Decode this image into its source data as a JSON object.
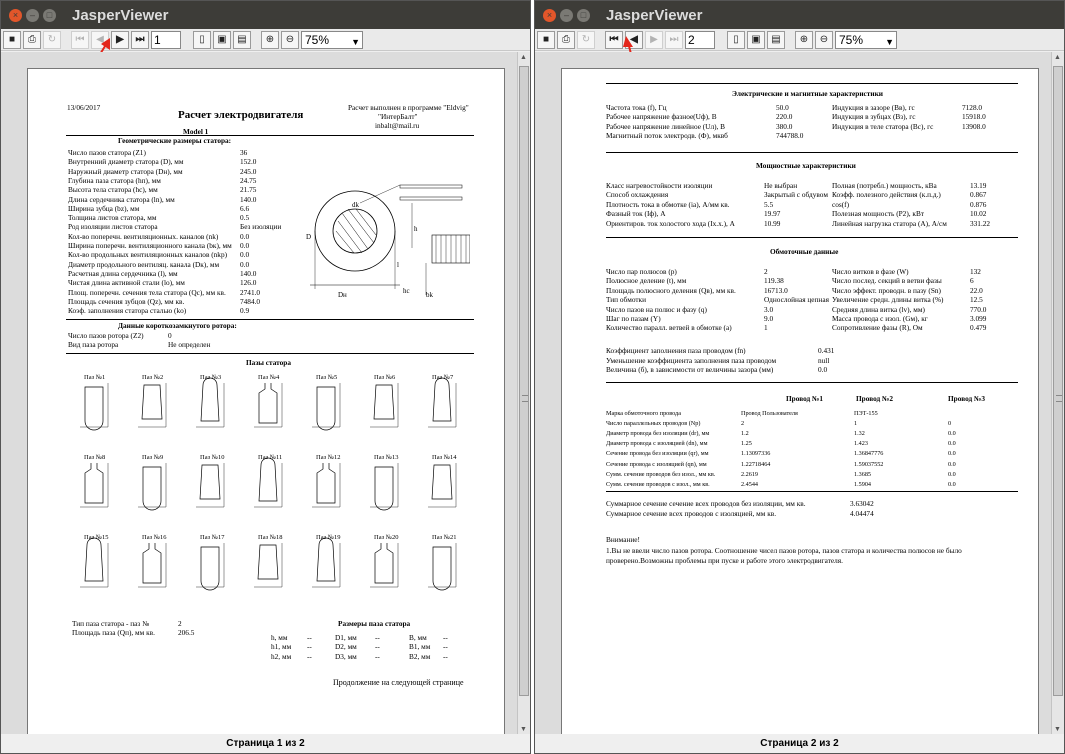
{
  "windows": [
    {
      "title": "JasperViewer",
      "page_field": "1",
      "zoom": "75%",
      "status": "Страница 1 из 2"
    },
    {
      "title": "JasperViewer",
      "page_field": "2",
      "zoom": "75%",
      "status": "Страница 2 из 2"
    }
  ],
  "icons": {
    "save": "save-icon",
    "print": "printer-icon",
    "reload": "reload-icon",
    "first": "first-page-icon",
    "prev": "previous-page-icon",
    "next": "next-page-icon",
    "last": "last-page-icon",
    "actual": "actual-size-icon",
    "fitpage": "fit-page-icon",
    "fitwidth": "fit-width-icon",
    "zoomin": "zoom-in-icon",
    "zoomout": "zoom-out-icon"
  },
  "accent_red": "#e3261b",
  "report1": {
    "date": "13/06/2017",
    "title": "Расчет электродвигателя",
    "model": "Model 1",
    "program_line": "Расчет выполнен в программе \"Eldvig\"",
    "company": "\"ИнтерБалт\"",
    "email": "inbalt@mail.ru",
    "stator_header": "Геометрические размеры статора:",
    "stator_rows": [
      [
        "Число пазов статора (Z1)",
        "36"
      ],
      [
        "Внутренний диаметр статора (D), мм",
        "152.0"
      ],
      [
        "Наружный диаметр статора (Dн), мм",
        "245.0"
      ],
      [
        "Глубина паза статора (hп), мм",
        "24.75"
      ],
      [
        "Высота тела статора (hc), мм",
        "21.75"
      ],
      [
        "Длина сердечника статора (ln), мм",
        "140.0"
      ],
      [
        "Ширина зубца (bz), мм",
        "6.6"
      ],
      [
        "Толщина листов статора, мм",
        "0.5"
      ],
      [
        "Род изоляции листов статора",
        "Без изоляции"
      ],
      [
        "Кол-во поперечн. вентиляционных. каналов (nk)",
        "0.0"
      ],
      [
        "Ширина поперечн. вентиляционного канала (bк), мм",
        "0.0"
      ],
      [
        "Кол-во продольных вентиляционных каналов (nkp)",
        "0.0"
      ],
      [
        "Диаметр продольного вентиляц. канала (Dк), мм",
        "0.0"
      ],
      [
        "Расчетная длина сердечника (l), мм",
        "140.0"
      ],
      [
        "Чистая длина активной стали (lo), мм",
        "126.0"
      ],
      [
        "Площ. поперечн. сечения тела статора (Qc), мм кв.",
        "2741.0"
      ],
      [
        "Площадь сечения зубцов (Qz), мм кв.",
        "7484.0"
      ],
      [
        "Коэф. заполнения статора сталью (ko)",
        "0.9"
      ]
    ],
    "rotor_header": "Данные короткозамкнутого ротора:",
    "rotor_rows": [
      [
        "Число пазов ротора (Z2)",
        "0"
      ],
      [
        "Вид паза ротора",
        "Не определен"
      ]
    ],
    "slots_header": "Пазы статора",
    "slot_labels": [
      "Паз №1",
      "Паз №2",
      "Паз №3",
      "Паз №4",
      "Паз №5",
      "Паз №6",
      "Паз №7",
      "Паз №8",
      "Паз №9",
      "Паз №10",
      "Паз №11",
      "Паз №12",
      "Паз №13",
      "Паз №14",
      "Паз №15",
      "Паз №16",
      "Паз №17",
      "Паз №18",
      "Паз №19",
      "Паз №20",
      "Паз №21"
    ],
    "slot_type_label": "Тип паза статора - паз №",
    "slot_type_value": "2",
    "slot_area_label": "Площадь паза (Qп), мм кв.",
    "slot_area_value": "206.5",
    "dims_header": "Размеры паза статора",
    "dims_rows": [
      [
        "h, мм",
        "--",
        "D1, мм",
        "--",
        "B, мм",
        "--"
      ],
      [
        "h1, мм",
        "--",
        "D2, мм",
        "--",
        "B1, мм",
        "--"
      ],
      [
        "h2, мм",
        "--",
        "D3, мм",
        "--",
        "B2, мм",
        "--"
      ]
    ],
    "continued": "Продолжение на следующей странице",
    "drawing_labels": {
      "dk": "dk",
      "dn": "Dн",
      "l": "l",
      "bk": "bk",
      "hc": "hc",
      "h": "h",
      "d": "D"
    }
  },
  "report2": {
    "em_header": "Электрические и магнитные характеристики",
    "em_left": [
      [
        "Частота тока (f), Гц",
        "50.0"
      ],
      [
        "Рабочее напряжение фазное(Uф), В",
        "220.0"
      ],
      [
        "Рабочее напряжение линейное (Uл), В",
        "380.0"
      ],
      [
        "Магнитный поток электродв. (Ф), мквб",
        "744788.0"
      ]
    ],
    "em_right": [
      [
        "Индукция в зазоре (Вв), гс",
        "7128.0"
      ],
      [
        "Индукция в зубцах (Вз), гс",
        "15918.0"
      ],
      [
        "Индукция в теле статора (Вс), гс",
        "13908.0"
      ]
    ],
    "power_header": "Мощностные характеристики",
    "power_left": [
      [
        "Класс нагревостойкости изоляции",
        "Не выбран"
      ],
      [
        "Способ охлаждения",
        "Закрытый с обдувом"
      ],
      [
        "Плотность тока в обмотке (ia), А/мм кв.",
        "5.5"
      ],
      [
        "Фазный ток (Iф), А",
        "19.97"
      ],
      [
        "Ориентиров. ток холостого хода (Ix.x.), А",
        "10.99"
      ]
    ],
    "power_right": [
      [
        "Полная (потребл.) мощность, кВа",
        "13.19"
      ],
      [
        "Коэфф. полезного действия (к.п.д.)",
        "0.867"
      ],
      [
        "cos(f)",
        "0.876"
      ],
      [
        "Полезная мощность (P2), кВт",
        "10.02"
      ],
      [
        "Линейная нагрузка статора (А), А/см",
        "331.22"
      ]
    ],
    "winding_header": "Обмоточные данные",
    "winding_left": [
      [
        "Число пар полюсов (р)",
        "2"
      ],
      [
        "Полюсное деление (t), мм",
        "119.38"
      ],
      [
        "Площадь полюсного деления (Qв), мм кв.",
        "16713.0"
      ],
      [
        "Тип обмотки",
        "Однослойная цепная"
      ],
      [
        "Число пазов на полюс и фазу (q)",
        "3.0"
      ],
      [
        "Шаг по пазам (Y)",
        "9.0"
      ],
      [
        "Количество паралл. ветвей в обмотке (a)",
        "1"
      ]
    ],
    "winding_right": [
      [
        "Число витков в фазе (W)",
        "132"
      ],
      [
        "Число послед. секций в ветви фазы",
        "6"
      ],
      [
        "Число эффект. проводн. в пазу (Sn)",
        "22.0"
      ],
      [
        "Увеличение средн. длины витка (%)",
        "12.5"
      ],
      [
        "Средняя длина витка (lv), мм)",
        "770.0"
      ],
      [
        "Масса провода с изол. (Gм), кг",
        "3.099"
      ],
      [
        "Сопротивление фазы (R), Ом",
        "0.479"
      ]
    ],
    "fill_rows": [
      [
        "Коэффициент заполнения паза проводом (fn)",
        "0.431"
      ],
      [
        "Уменьшение коэффициента заполнения паза проводом",
        "null"
      ],
      [
        "Величина (б), в зависимости от величины зазора (мм)",
        "0.0"
      ]
    ],
    "wire_cols": [
      "Провод №1",
      "Провод №2",
      "Провод №3"
    ],
    "wire_rows": [
      [
        "Марка обмоточного провода",
        "Провод Пользователя",
        "ПЭТ-155",
        ""
      ],
      [
        "Число параллельных проводов (Np)",
        "2",
        "1",
        "0"
      ],
      [
        "Диаметр провода без изоляции (dr), мм",
        "1.2",
        "1.32",
        "0.0"
      ],
      [
        "Диаметр провода с изоляцией (dn), мм",
        "1.25",
        "1.423",
        "0.0"
      ],
      [
        "Сечение провода без изоляции (qr), мм",
        "1.13097336",
        "1.36847776",
        "0.0"
      ],
      [
        "Сечение провода с изоляцией (qn), мм",
        "1.22718464",
        "1.59037552",
        "0.0"
      ],
      [
        "Сумм. сечение проводов без изол., мм кв.",
        "2.2619",
        "1.3685",
        "0.0"
      ],
      [
        "Сумм. сечение проводов с изол., мм кв.",
        "2.4544",
        "1.5904",
        "0.0"
      ]
    ],
    "sum_rows": [
      [
        "Суммарное сечение сечение всех проводов без изоляции, мм кв.",
        "3.63042"
      ],
      [
        "Суммарное сечение всех проводов с изоляцией, мм кв.",
        "4.04474"
      ]
    ],
    "attention": "Внимание!",
    "warning": "1.Вы не ввели число пазов ротора. Соотношение чисел пазов ротора, пазов статора и количества полюсов не было проверено.Возможны проблемы при пуске и работе этого электродвигателя."
  }
}
